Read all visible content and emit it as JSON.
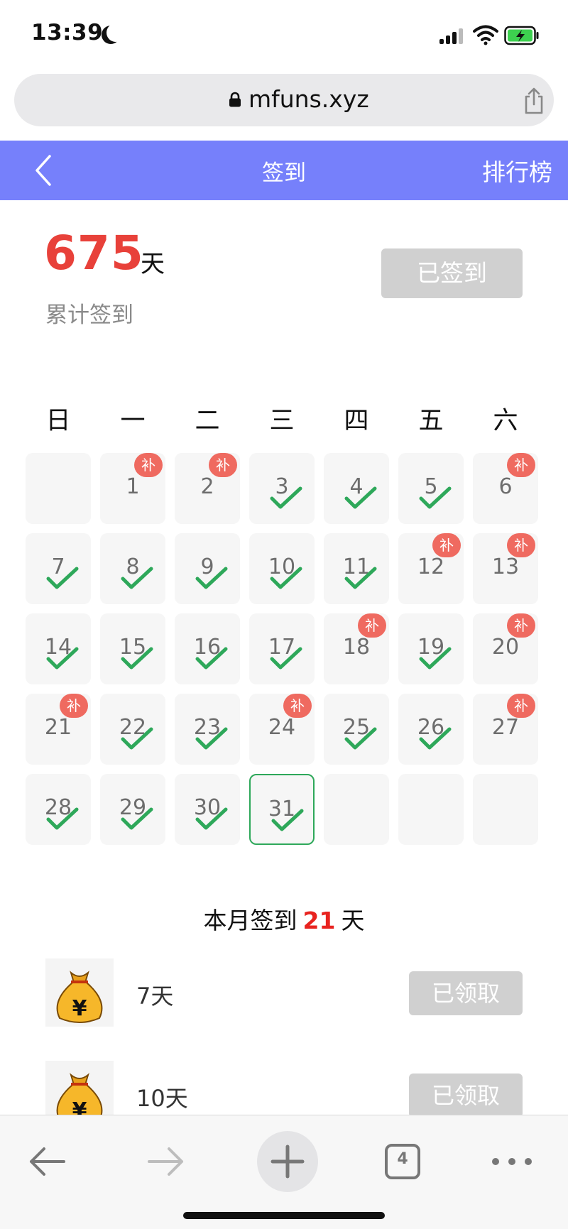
{
  "status_bar": {
    "time": "13:39"
  },
  "url_bar": {
    "url": "mfuns.xyz"
  },
  "header": {
    "title": "签到",
    "ranking": "排行榜"
  },
  "summary": {
    "total": "675",
    "unit": "天",
    "label": "累计签到",
    "button": "已签到"
  },
  "calendar": {
    "weekdays": [
      "日",
      "一",
      "二",
      "三",
      "四",
      "五",
      "六"
    ],
    "makeup_badge": "补",
    "days": [
      {
        "day": "",
        "checked": false,
        "makeup": false
      },
      {
        "day": "1",
        "checked": false,
        "makeup": true
      },
      {
        "day": "2",
        "checked": false,
        "makeup": true
      },
      {
        "day": "3",
        "checked": true,
        "makeup": false
      },
      {
        "day": "4",
        "checked": true,
        "makeup": false
      },
      {
        "day": "5",
        "checked": true,
        "makeup": false
      },
      {
        "day": "6",
        "checked": false,
        "makeup": true
      },
      {
        "day": "7",
        "checked": true,
        "makeup": false
      },
      {
        "day": "8",
        "checked": true,
        "makeup": false
      },
      {
        "day": "9",
        "checked": true,
        "makeup": false
      },
      {
        "day": "10",
        "checked": true,
        "makeup": false
      },
      {
        "day": "11",
        "checked": true,
        "makeup": false
      },
      {
        "day": "12",
        "checked": false,
        "makeup": true
      },
      {
        "day": "13",
        "checked": false,
        "makeup": true
      },
      {
        "day": "14",
        "checked": true,
        "makeup": false
      },
      {
        "day": "15",
        "checked": true,
        "makeup": false
      },
      {
        "day": "16",
        "checked": true,
        "makeup": false
      },
      {
        "day": "17",
        "checked": true,
        "makeup": false
      },
      {
        "day": "18",
        "checked": false,
        "makeup": true
      },
      {
        "day": "19",
        "checked": true,
        "makeup": false
      },
      {
        "day": "20",
        "checked": false,
        "makeup": true
      },
      {
        "day": "21",
        "checked": false,
        "makeup": true
      },
      {
        "day": "22",
        "checked": true,
        "makeup": false
      },
      {
        "day": "23",
        "checked": true,
        "makeup": false
      },
      {
        "day": "24",
        "checked": false,
        "makeup": true
      },
      {
        "day": "25",
        "checked": true,
        "makeup": false
      },
      {
        "day": "26",
        "checked": true,
        "makeup": false
      },
      {
        "day": "27",
        "checked": false,
        "makeup": true
      },
      {
        "day": "28",
        "checked": true,
        "makeup": false
      },
      {
        "day": "29",
        "checked": true,
        "makeup": false
      },
      {
        "day": "30",
        "checked": true,
        "makeup": false
      },
      {
        "day": "31",
        "checked": true,
        "makeup": false,
        "today": true
      },
      {
        "day": "",
        "checked": false,
        "makeup": false
      },
      {
        "day": "",
        "checked": false,
        "makeup": false
      },
      {
        "day": "",
        "checked": false,
        "makeup": false
      }
    ]
  },
  "month_summary": {
    "prefix": "本月签到",
    "count": "21",
    "suffix": "天"
  },
  "rewards": [
    {
      "label": "7天",
      "button": "已领取",
      "icon": "money-bag-icon"
    },
    {
      "label": "10天",
      "button": "已领取",
      "icon": "money-bag-icon"
    }
  ],
  "toolbar": {
    "tabs_count": "4"
  },
  "colors": {
    "accent": "#7680fb",
    "count_red": "#e8413a",
    "check_green": "#2ea85a",
    "badge_red": "#ef6a60"
  }
}
